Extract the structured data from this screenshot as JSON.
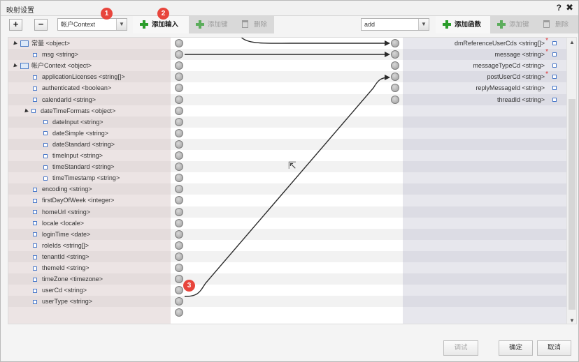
{
  "window": {
    "title": "映射设置",
    "help": "?",
    "close": "✖"
  },
  "toolbar": {
    "add_symbol": "+",
    "remove_symbol": "−",
    "context_select": "帐户Context",
    "add_input": "添加输入",
    "add_key": "添加键",
    "delete": "删除",
    "target_select": "add",
    "add_function": "添加函数",
    "add_key_right": "添加键",
    "delete_right": "删除"
  },
  "badges": [
    "1",
    "2",
    "3"
  ],
  "left_fields": [
    {
      "label": "常量 <object>",
      "level": 0,
      "kind": "object"
    },
    {
      "label": "msg <string>",
      "level": 1,
      "kind": "field"
    },
    {
      "label": "帐户Context <object>",
      "level": 0,
      "kind": "object"
    },
    {
      "label": "applicationLicenses <string[]>",
      "level": 1,
      "kind": "field"
    },
    {
      "label": "authenticated <boolean>",
      "level": 1,
      "kind": "field"
    },
    {
      "label": "calendarId <string>",
      "level": 1,
      "kind": "field"
    },
    {
      "label": "dateTimeFormats <object>",
      "level": 1,
      "kind": "group"
    },
    {
      "label": "dateInput <string>",
      "level": 2,
      "kind": "field"
    },
    {
      "label": "dateSimple <string>",
      "level": 2,
      "kind": "field"
    },
    {
      "label": "dateStandard <string>",
      "level": 2,
      "kind": "field"
    },
    {
      "label": "timeInput <string>",
      "level": 2,
      "kind": "field"
    },
    {
      "label": "timeStandard <string>",
      "level": 2,
      "kind": "field"
    },
    {
      "label": "timeTimestamp <string>",
      "level": 2,
      "kind": "field"
    },
    {
      "label": "encoding <string>",
      "level": 1,
      "kind": "field"
    },
    {
      "label": "firstDayOfWeek <integer>",
      "level": 1,
      "kind": "field"
    },
    {
      "label": "homeUrl <string>",
      "level": 1,
      "kind": "field"
    },
    {
      "label": "locale <locale>",
      "level": 1,
      "kind": "field"
    },
    {
      "label": "loginTime <date>",
      "level": 1,
      "kind": "field"
    },
    {
      "label": "roleIds <string[]>",
      "level": 1,
      "kind": "field"
    },
    {
      "label": "tenantId <string>",
      "level": 1,
      "kind": "field"
    },
    {
      "label": "themeId <string>",
      "level": 1,
      "kind": "field"
    },
    {
      "label": "timeZone <timezone>",
      "level": 1,
      "kind": "field"
    },
    {
      "label": "userCd <string>",
      "level": 1,
      "kind": "field"
    },
    {
      "label": "userType <string>",
      "level": 1,
      "kind": "field"
    }
  ],
  "right_fields": [
    {
      "label": "dmReferenceUserCds <string[]>",
      "required": true
    },
    {
      "label": "message <string>",
      "required": true
    },
    {
      "label": "messageTypeCd <string>",
      "required": false
    },
    {
      "label": "postUserCd <string>",
      "required": true
    },
    {
      "label": "replyMessageId <string>",
      "required": false
    },
    {
      "label": "threadId <string>",
      "required": false
    }
  ],
  "required_mark": "*",
  "buttons": {
    "test": "调试",
    "ok": "确定",
    "cancel": "取消"
  },
  "colors": {
    "accent_green": "#2a9d2a",
    "badge_red": "#e8453c",
    "field_blue": "#4a79c9"
  }
}
